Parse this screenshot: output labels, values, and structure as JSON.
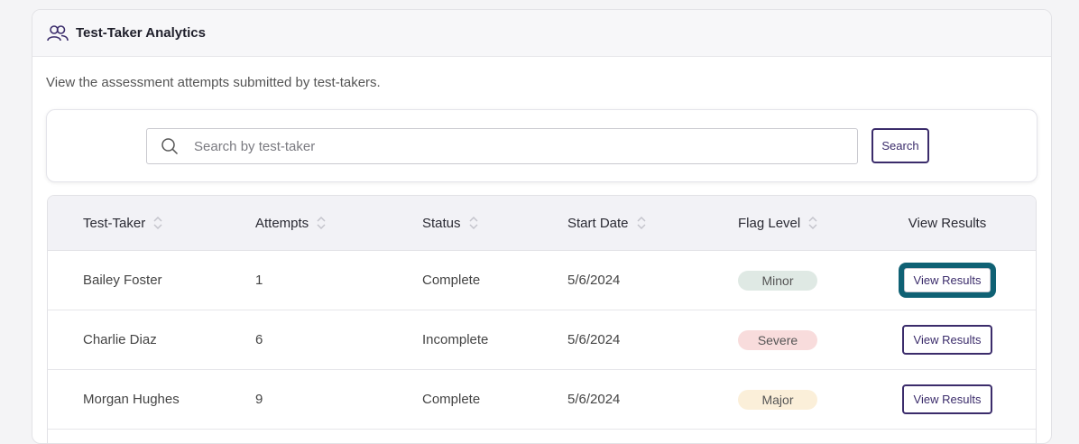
{
  "header": {
    "title": "Test-Taker Analytics",
    "icon": "users-icon"
  },
  "description": "View the assessment attempts submitted by test-takers.",
  "search": {
    "placeholder": "Search by test-taker",
    "value": "",
    "button_label": "Search"
  },
  "table": {
    "columns": [
      {
        "label": "Test-Taker",
        "sortable": true
      },
      {
        "label": "Attempts",
        "sortable": true
      },
      {
        "label": "Status",
        "sortable": true
      },
      {
        "label": "Start Date",
        "sortable": true
      },
      {
        "label": "Flag Level",
        "sortable": true
      },
      {
        "label": "View Results",
        "sortable": false
      }
    ],
    "rows": [
      {
        "name": "Bailey Foster",
        "attempts": "1",
        "status": "Complete",
        "start_date": "5/6/2024",
        "flag": "Minor",
        "action": "View Results"
      },
      {
        "name": "Charlie Diaz",
        "attempts": "6",
        "status": "Incomplete",
        "start_date": "5/6/2024",
        "flag": "Severe",
        "action": "View Results"
      },
      {
        "name": "Morgan Hughes",
        "attempts": "9",
        "status": "Complete",
        "start_date": "5/6/2024",
        "flag": "Major",
        "action": "View Results"
      }
    ]
  },
  "colors": {
    "accent": "#3b2c6b",
    "focus_ring": "#0f6174",
    "flag_minor": "#dfe9e4",
    "flag_severe": "#f8dcdc",
    "flag_major": "#fbefd9"
  }
}
